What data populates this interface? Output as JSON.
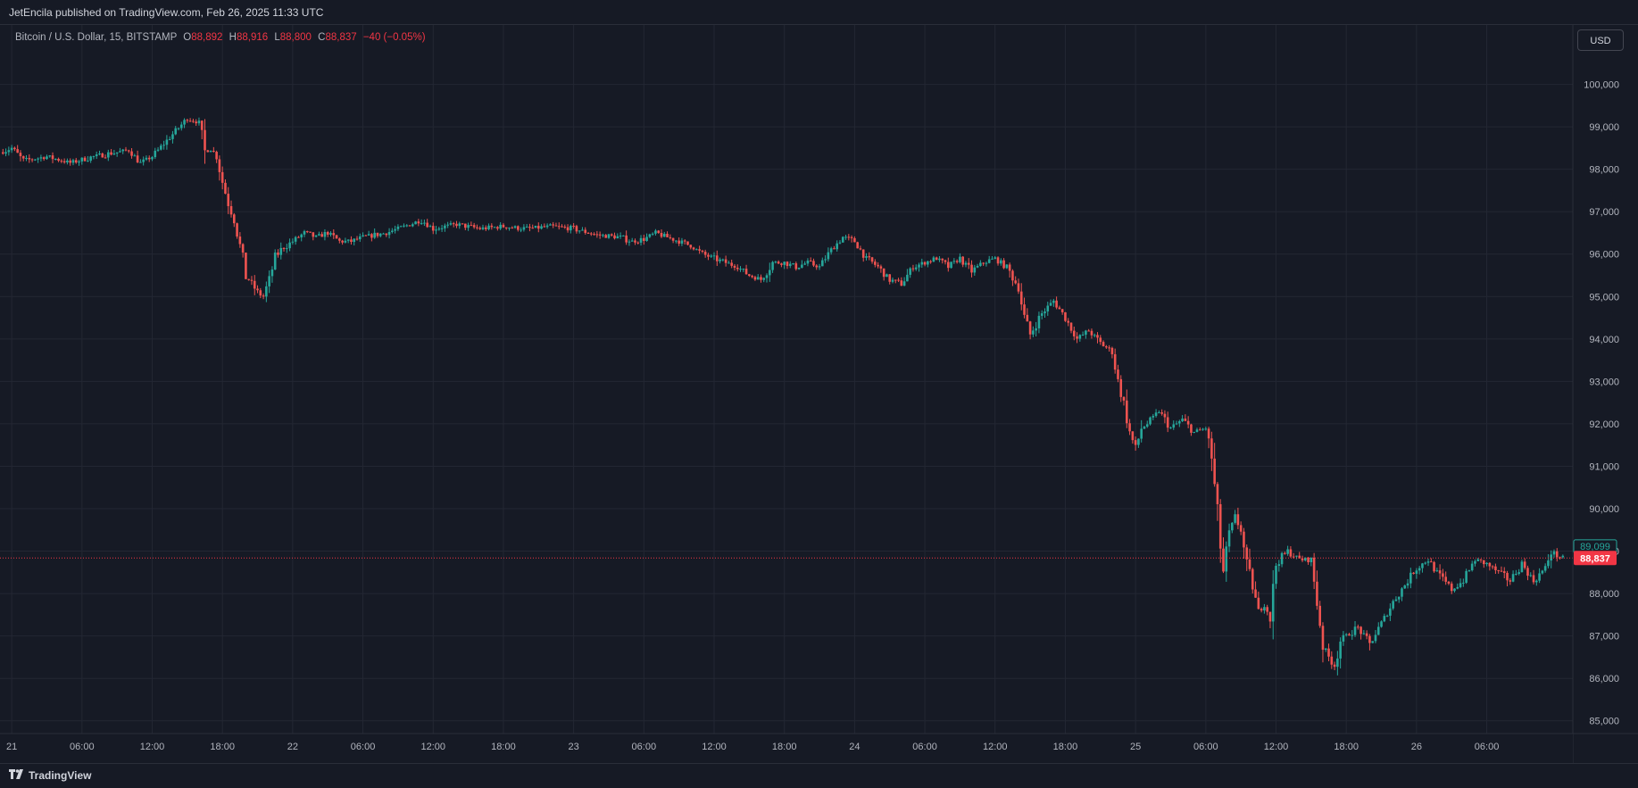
{
  "header": {
    "published": "JetEncila published on TradingView.com, Feb 26, 2025 11:33 UTC"
  },
  "legend": {
    "symbol": "Bitcoin / U.S. Dollar, 15, BITSTAMP",
    "open_label": "O",
    "open": "88,892",
    "high_label": "H",
    "high": "88,916",
    "low_label": "L",
    "low": "88,800",
    "close_label": "C",
    "close": "88,837",
    "change": "−40 (−0.05%)"
  },
  "currency_button": "USD",
  "footer": {
    "brand": "TradingView",
    "brand_icon": "tradingview-logo-icon"
  },
  "colors": {
    "up": "#26a69a",
    "down": "#ef5350",
    "background": "#161a25",
    "grid": "#232733",
    "last_price_bg": "#f23645",
    "prev_close_bg": "#26a69a"
  },
  "chart_data": {
    "type": "candlestick",
    "title": "Bitcoin / U.S. Dollar, 15, BITSTAMP",
    "interval": "15",
    "ylim": [
      84700,
      101400
    ],
    "y_ticks": [
      85000,
      86000,
      87000,
      88000,
      89000,
      90000,
      91000,
      92000,
      93000,
      94000,
      95000,
      96000,
      97000,
      98000,
      99000,
      100000
    ],
    "y_tick_labels": [
      "85,000",
      "86,000",
      "87,000",
      "88,000",
      "89,000",
      "90,000",
      "91,000",
      "92,000",
      "93,000",
      "94,000",
      "95,000",
      "96,000",
      "97,000",
      "98,000",
      "99,000",
      "100,000"
    ],
    "x_range": [
      "Feb 20 23:00",
      "Feb 26 11:30"
    ],
    "x_ticks": [
      {
        "label": "21",
        "hour": 24
      },
      {
        "label": "06:00",
        "hour": 30
      },
      {
        "label": "12:00",
        "hour": 36
      },
      {
        "label": "18:00",
        "hour": 42
      },
      {
        "label": "22",
        "hour": 48
      },
      {
        "label": "06:00",
        "hour": 54
      },
      {
        "label": "12:00",
        "hour": 60
      },
      {
        "label": "18:00",
        "hour": 66
      },
      {
        "label": "23",
        "hour": 72
      },
      {
        "label": "06:00",
        "hour": 78
      },
      {
        "label": "12:00",
        "hour": 84
      },
      {
        "label": "18:00",
        "hour": 90
      },
      {
        "label": "24",
        "hour": 96
      },
      {
        "label": "06:00",
        "hour": 102
      },
      {
        "label": "12:00",
        "hour": 108
      },
      {
        "label": "18:00",
        "hour": 114
      },
      {
        "label": "25",
        "hour": 120
      },
      {
        "label": "06:00",
        "hour": 126
      },
      {
        "label": "12:00",
        "hour": 132
      },
      {
        "label": "18:00",
        "hour": 138
      },
      {
        "label": "26",
        "hour": 144
      },
      {
        "label": "06:00",
        "hour": 150
      }
    ],
    "price_path": [
      [
        23.0,
        98400
      ],
      [
        24.0,
        98500
      ],
      [
        25.0,
        98200
      ],
      [
        27.0,
        98300
      ],
      [
        29.0,
        98150
      ],
      [
        31.0,
        98300
      ],
      [
        33.0,
        98400
      ],
      [
        34.0,
        98450
      ],
      [
        35.0,
        98150
      ],
      [
        36.0,
        98300
      ],
      [
        37.0,
        98600
      ],
      [
        38.0,
        98900
      ],
      [
        39.0,
        99200
      ],
      [
        40.0,
        99100
      ],
      [
        40.5,
        98400
      ],
      [
        41.0,
        98500
      ],
      [
        41.5,
        98300
      ],
      [
        42.0,
        97700
      ],
      [
        42.5,
        97200
      ],
      [
        43.0,
        96800
      ],
      [
        43.5,
        96200
      ],
      [
        44.0,
        95500
      ],
      [
        44.5,
        95300
      ],
      [
        45.0,
        95100
      ],
      [
        45.5,
        95000
      ],
      [
        46.0,
        95400
      ],
      [
        46.5,
        95900
      ],
      [
        47.0,
        96100
      ],
      [
        48.0,
        96300
      ],
      [
        49.0,
        96500
      ],
      [
        50.0,
        96400
      ],
      [
        51.0,
        96500
      ],
      [
        52.0,
        96300
      ],
      [
        53.0,
        96300
      ],
      [
        54.0,
        96400
      ],
      [
        56.0,
        96500
      ],
      [
        58.0,
        96700
      ],
      [
        59.0,
        96800
      ],
      [
        60.0,
        96600
      ],
      [
        62.0,
        96700
      ],
      [
        64.0,
        96600
      ],
      [
        66.0,
        96650
      ],
      [
        68.0,
        96600
      ],
      [
        70.0,
        96650
      ],
      [
        72.0,
        96600
      ],
      [
        74.0,
        96450
      ],
      [
        76.0,
        96400
      ],
      [
        77.0,
        96300
      ],
      [
        78.0,
        96350
      ],
      [
        79.0,
        96500
      ],
      [
        80.0,
        96400
      ],
      [
        82.0,
        96200
      ],
      [
        83.0,
        96000
      ],
      [
        84.0,
        95900
      ],
      [
        85.0,
        95800
      ],
      [
        86.0,
        95700
      ],
      [
        87.0,
        95500
      ],
      [
        88.0,
        95400
      ],
      [
        89.0,
        95800
      ],
      [
        90.0,
        95800
      ],
      [
        91.0,
        95700
      ],
      [
        92.0,
        95800
      ],
      [
        93.0,
        95700
      ],
      [
        94.0,
        96100
      ],
      [
        95.0,
        96400
      ],
      [
        96.0,
        96300
      ],
      [
        97.0,
        95900
      ],
      [
        98.0,
        95700
      ],
      [
        99.0,
        95400
      ],
      [
        100.0,
        95300
      ],
      [
        101.0,
        95700
      ],
      [
        102.0,
        95800
      ],
      [
        103.0,
        95900
      ],
      [
        104.0,
        95700
      ],
      [
        105.0,
        95900
      ],
      [
        106.0,
        95600
      ],
      [
        107.0,
        95800
      ],
      [
        108.0,
        95900
      ],
      [
        109.0,
        95700
      ],
      [
        110.0,
        95200
      ],
      [
        110.5,
        94500
      ],
      [
        111.0,
        94100
      ],
      [
        112.0,
        94600
      ],
      [
        113.0,
        94900
      ],
      [
        114.0,
        94500
      ],
      [
        115.0,
        94000
      ],
      [
        116.0,
        94200
      ],
      [
        117.0,
        93900
      ],
      [
        118.0,
        93700
      ],
      [
        118.5,
        93000
      ],
      [
        119.0,
        92500
      ],
      [
        119.5,
        91800
      ],
      [
        120.0,
        91400
      ],
      [
        120.5,
        91900
      ],
      [
        121.0,
        92000
      ],
      [
        122.0,
        92300
      ],
      [
        123.0,
        91900
      ],
      [
        124.0,
        92100
      ],
      [
        125.0,
        91800
      ],
      [
        126.0,
        91900
      ],
      [
        126.5,
        91200
      ],
      [
        127.0,
        89800
      ],
      [
        127.5,
        88500
      ],
      [
        128.0,
        89400
      ],
      [
        128.5,
        89800
      ],
      [
        129.0,
        89500
      ],
      [
        129.5,
        88600
      ],
      [
        130.0,
        88200
      ],
      [
        130.5,
        87500
      ],
      [
        131.0,
        87800
      ],
      [
        131.5,
        87400
      ],
      [
        132.0,
        88700
      ],
      [
        133.0,
        89000
      ],
      [
        134.0,
        88800
      ],
      [
        135.0,
        88800
      ],
      [
        135.5,
        87800
      ],
      [
        136.0,
        86800
      ],
      [
        136.5,
        86500
      ],
      [
        137.0,
        86300
      ],
      [
        137.5,
        86900
      ],
      [
        138.0,
        87000
      ],
      [
        139.0,
        87200
      ],
      [
        140.0,
        86800
      ],
      [
        141.0,
        87300
      ],
      [
        142.0,
        87800
      ],
      [
        143.0,
        88200
      ],
      [
        143.5,
        88400
      ],
      [
        144.0,
        88600
      ],
      [
        145.0,
        88800
      ],
      [
        146.0,
        88400
      ],
      [
        147.0,
        88100
      ],
      [
        148.0,
        88300
      ],
      [
        149.0,
        88800
      ],
      [
        150.0,
        88700
      ],
      [
        151.0,
        88500
      ],
      [
        152.0,
        88300
      ],
      [
        153.0,
        88700
      ],
      [
        154.0,
        88300
      ],
      [
        155.0,
        88600
      ],
      [
        155.5,
        89000
      ],
      [
        156.0,
        88900
      ],
      [
        156.5,
        88837
      ]
    ],
    "last_price": {
      "value": 88837,
      "label": "88,837"
    },
    "previous_close": {
      "value": 89099,
      "label": "89,099"
    },
    "grid": true,
    "price_scale": "right"
  }
}
